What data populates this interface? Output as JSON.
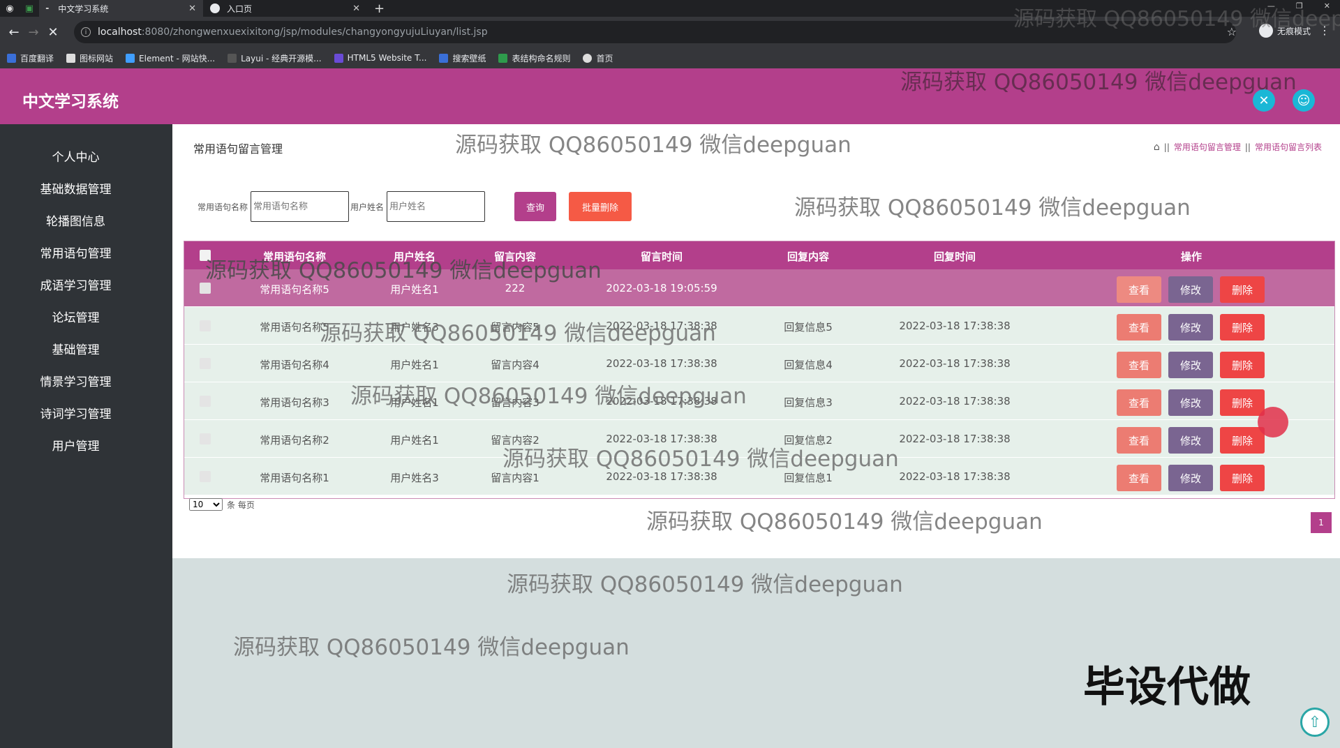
{
  "browser": {
    "tabs": [
      {
        "title": "中文学习系统",
        "active": true
      },
      {
        "title": "入口页",
        "active": false
      }
    ],
    "url_host": "localhost",
    "url_path": ":8080/zhongwenxuexixitong/jsp/modules/changyongyujuLiuyan/list.jsp",
    "incognito_label": "无痕模式",
    "bookmarks": [
      "百度翻译",
      "图标网站",
      "Element - 网站快...",
      "Layui - 经典开源模...",
      "HTML5 Website T...",
      "搜索壁纸",
      "表结构命名规则",
      "首页"
    ]
  },
  "app": {
    "title": "中文学习系统",
    "accent": "#b33f8b"
  },
  "sidebar": {
    "items": [
      "个人中心",
      "基础数据管理",
      "轮播图信息",
      "常用语句管理",
      "成语学习管理",
      "论坛管理",
      "基础管理",
      "情景学习管理",
      "诗词学习管理",
      "用户管理"
    ]
  },
  "page": {
    "title": "常用语句留言管理",
    "breadcrumb": [
      "常用语句留言管理",
      "常用语句留言列表"
    ]
  },
  "search": {
    "field1_label": "常用语句名称",
    "field1_placeholder": "常用语句名称",
    "field2_label": "用户姓名",
    "field2_placeholder": "用户姓名",
    "query_button": "查询",
    "batch_delete_button": "批量删除"
  },
  "table": {
    "headers": [
      "常用语句名称",
      "用户姓名",
      "留言内容",
      "留言时间",
      "回复内容",
      "回复时间",
      "操作"
    ],
    "rows": [
      {
        "name": "常用语句名称5",
        "user": "用户姓名1",
        "content": "222",
        "time": "2022-03-18 19:05:59",
        "reply": "",
        "reply_time": ""
      },
      {
        "name": "常用语句名称5",
        "user": "用户姓名3",
        "content": "留言内容5",
        "time": "2022-03-18 17:38:38",
        "reply": "回复信息5",
        "reply_time": "2022-03-18 17:38:38"
      },
      {
        "name": "常用语句名称4",
        "user": "用户姓名1",
        "content": "留言内容4",
        "time": "2022-03-18 17:38:38",
        "reply": "回复信息4",
        "reply_time": "2022-03-18 17:38:38"
      },
      {
        "name": "常用语句名称3",
        "user": "用户姓名1",
        "content": "留言内容3",
        "time": "2022-03-18 17:38:38",
        "reply": "回复信息3",
        "reply_time": "2022-03-18 17:38:38"
      },
      {
        "name": "常用语句名称2",
        "user": "用户姓名1",
        "content": "留言内容2",
        "time": "2022-03-18 17:38:38",
        "reply": "回复信息2",
        "reply_time": "2022-03-18 17:38:38"
      },
      {
        "name": "常用语句名称1",
        "user": "用户姓名3",
        "content": "留言内容1",
        "time": "2022-03-18 17:38:38",
        "reply": "回复信息1",
        "reply_time": "2022-03-18 17:38:38"
      }
    ],
    "actions": {
      "view": "查看",
      "edit": "修改",
      "delete": "删除"
    }
  },
  "pagination": {
    "page_size": "10",
    "page_size_suffix": "条 每页",
    "current_page": "1"
  },
  "overlay": {
    "watermark": "源码获取 QQ86050149 微信deepguan",
    "promo": "毕设代做"
  }
}
